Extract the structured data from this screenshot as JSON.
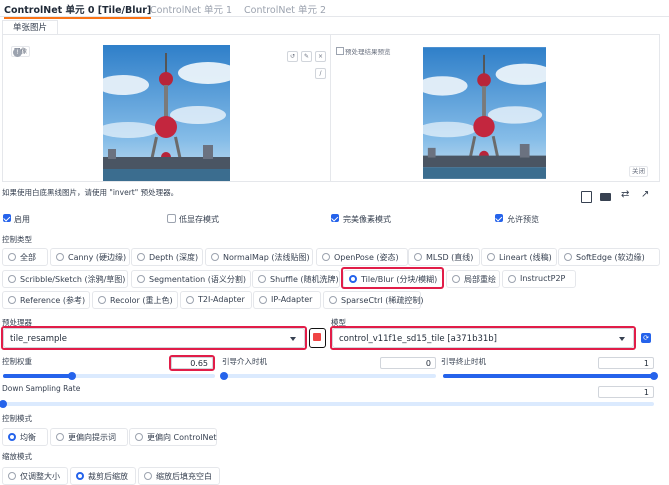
{
  "tabs": [
    "ControlNet 单元 0 [Tile/Blur]",
    "ControlNet 单元 1",
    "ControlNet 单元 2"
  ],
  "subtab": "单张图片",
  "image_panel": {
    "image_label": "图像",
    "preview_label": "预处理结果预览",
    "close_label": "关闭"
  },
  "invert_hint": "如果使用白底黑线图片，请使用 \"invert\" 预处理器。",
  "checkboxes": [
    {
      "label": "启用",
      "checked": true
    },
    {
      "label": "低显存模式",
      "checked": false
    },
    {
      "label": "完美像素模式",
      "checked": true
    },
    {
      "label": "允许预览",
      "checked": true
    }
  ],
  "control_type": {
    "heading": "控制类型",
    "options": [
      "全部",
      "Canny (硬边缘)",
      "Depth (深度)",
      "NormalMap (法线贴图)",
      "OpenPose (姿态)",
      "MLSD (直线)",
      "Lineart (线稿)",
      "SoftEdge (软边缘)",
      "Scribble/Sketch (涂鸦/草图)",
      "Segmentation (语义分割)",
      "Shuffle (随机洗牌)",
      "Tile/Blur (分块/模糊)",
      "局部重绘",
      "InstructP2P",
      "Reference (参考)",
      "Recolor (重上色)",
      "T2I-Adapter",
      "IP-Adapter",
      "SparseCtrl (稀疏控制)"
    ],
    "selected": "Tile/Blur (分块/模糊)"
  },
  "preprocessor": {
    "label": "预处理器",
    "value": "tile_resample"
  },
  "model": {
    "label": "模型",
    "value": "control_v11f1e_sd15_tile [a371b31b]"
  },
  "control_weight": {
    "label": "控制权重",
    "value": "0.65",
    "fraction": 0.325
  },
  "start_step": {
    "label": "引导介入时机",
    "value": "0",
    "fraction": 0
  },
  "end_step": {
    "label": "引导终止时机",
    "value": "1",
    "fraction": 1
  },
  "down_sampling": {
    "label": "Down Sampling Rate",
    "value": "1",
    "fraction": 0
  },
  "control_mode": {
    "heading": "控制模式",
    "options": [
      "均衡",
      "更偏向提示词",
      "更偏向 ControlNet"
    ],
    "selected": "均衡"
  },
  "resize_mode": {
    "heading": "缩放模式",
    "options": [
      "仅调整大小",
      "裁剪后缩放",
      "缩放后填充空白"
    ],
    "selected": "裁剪后缩放"
  },
  "colors": {
    "accent": "#2563eb",
    "highlight": "#e11d48",
    "tab_underline": "#f97316"
  }
}
